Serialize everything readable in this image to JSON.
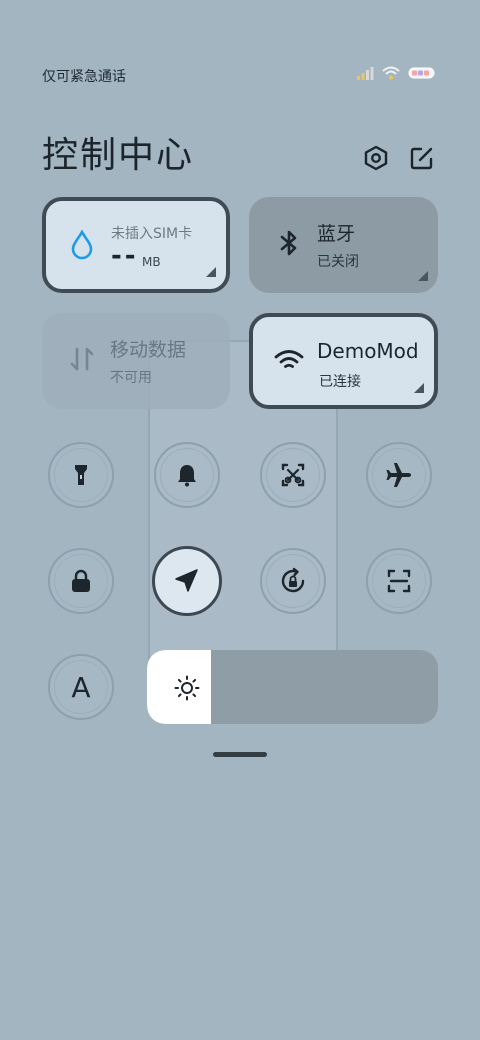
{
  "status_bar": {
    "carrier_text": "仅可紧急通话",
    "icons": [
      "signal-icon",
      "wifi-icon",
      "battery-icon"
    ]
  },
  "header": {
    "title": "控制中心",
    "settings_icon": "settings-hexagon-icon",
    "edit_icon": "edit-icon"
  },
  "tiles": {
    "data_usage": {
      "label": "未插入SIM卡",
      "value": "--",
      "unit": "MB",
      "icon": "water-drop-icon",
      "active": true
    },
    "bluetooth": {
      "label": "蓝牙",
      "status": "已关闭",
      "icon": "bluetooth-icon",
      "active": false
    },
    "mobile_data": {
      "label": "移动数据",
      "status": "不可用",
      "icon": "mobile-data-icon",
      "active": false
    },
    "wifi": {
      "label": "DemoMod",
      "status": "已连接",
      "icon": "wifi-icon",
      "active": true
    }
  },
  "toggles": [
    {
      "name": "flashlight",
      "icon": "flashlight-icon",
      "active": false
    },
    {
      "name": "silent",
      "icon": "bell-icon",
      "active": false
    },
    {
      "name": "screenshot",
      "icon": "screenshot-icon",
      "active": false
    },
    {
      "name": "airplane",
      "icon": "airplane-icon",
      "active": false
    },
    {
      "name": "lock",
      "icon": "lock-icon",
      "active": false
    },
    {
      "name": "location",
      "icon": "location-arrow-icon",
      "active": true
    },
    {
      "name": "rotation-lock",
      "icon": "rotation-lock-icon",
      "active": false
    },
    {
      "name": "scan",
      "icon": "scan-icon",
      "active": false
    },
    {
      "name": "auto-brightness",
      "icon": "auto-brightness-a-icon",
      "active": false
    }
  ],
  "auto_brightness_label": "A",
  "brightness": {
    "level": 0.22,
    "icon": "sun-icon"
  },
  "colors": {
    "background": "#a3b5c1",
    "active_tile": "#d7e3ec",
    "active_border": "#3f4c55",
    "wifi_blue": "#1e9be8"
  }
}
